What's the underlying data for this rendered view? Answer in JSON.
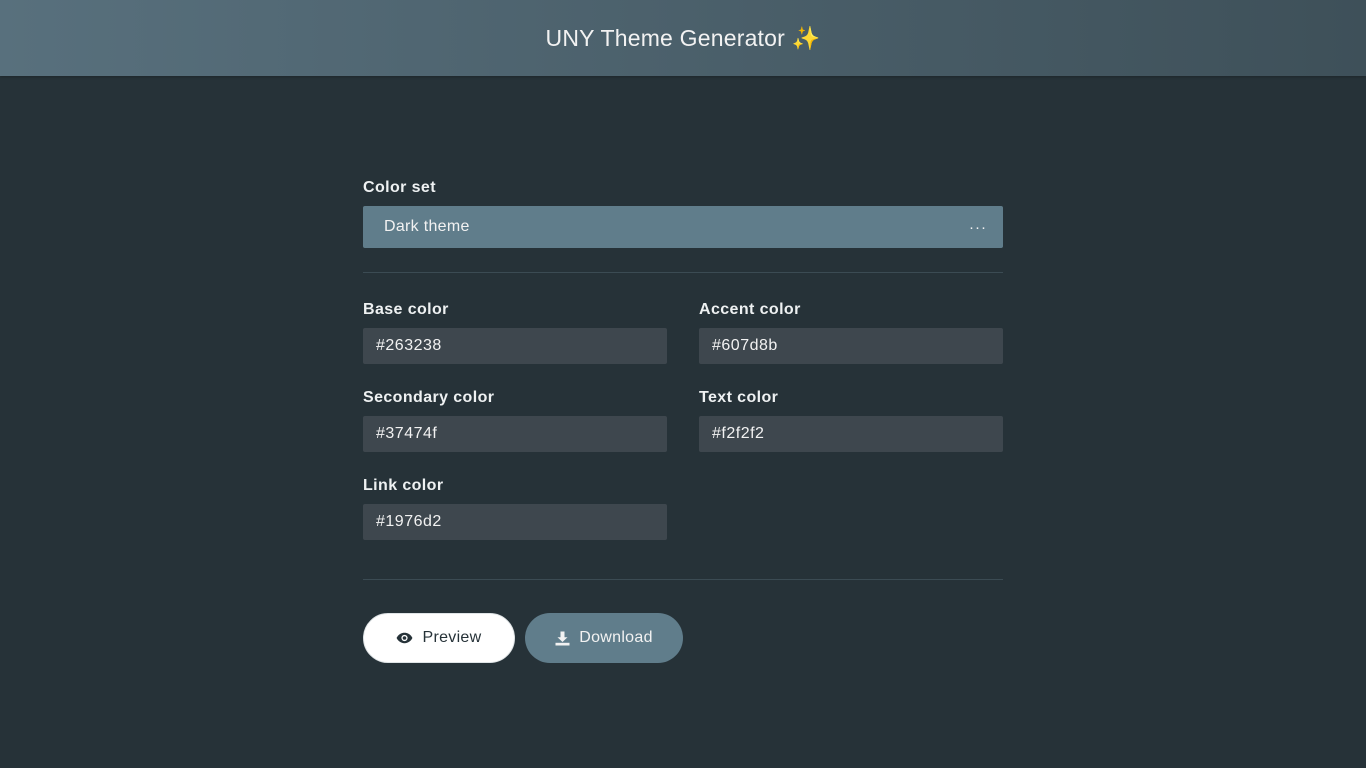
{
  "header": {
    "title": "UNY Theme Generator ✨"
  },
  "color_set": {
    "label": "Color set",
    "selected": "Dark theme",
    "menu_glyph": "···"
  },
  "fields": {
    "base": {
      "label": "Base color",
      "value": "#263238"
    },
    "accent": {
      "label": "Accent color",
      "value": "#607d8b"
    },
    "secondary": {
      "label": "Secondary color",
      "value": "#37474f"
    },
    "text": {
      "label": "Text color",
      "value": "#f2f2f2"
    },
    "link": {
      "label": "Link color",
      "value": "#1976d2"
    }
  },
  "actions": {
    "preview_label": "Preview",
    "preview_icon": "eye-icon",
    "download_label": "Download",
    "download_icon": "download-icon"
  },
  "colors": {
    "background": "#263238",
    "header": "#4e6470",
    "accent": "#607d8b",
    "input": "#3e474e",
    "text": "#f2f2f2"
  }
}
